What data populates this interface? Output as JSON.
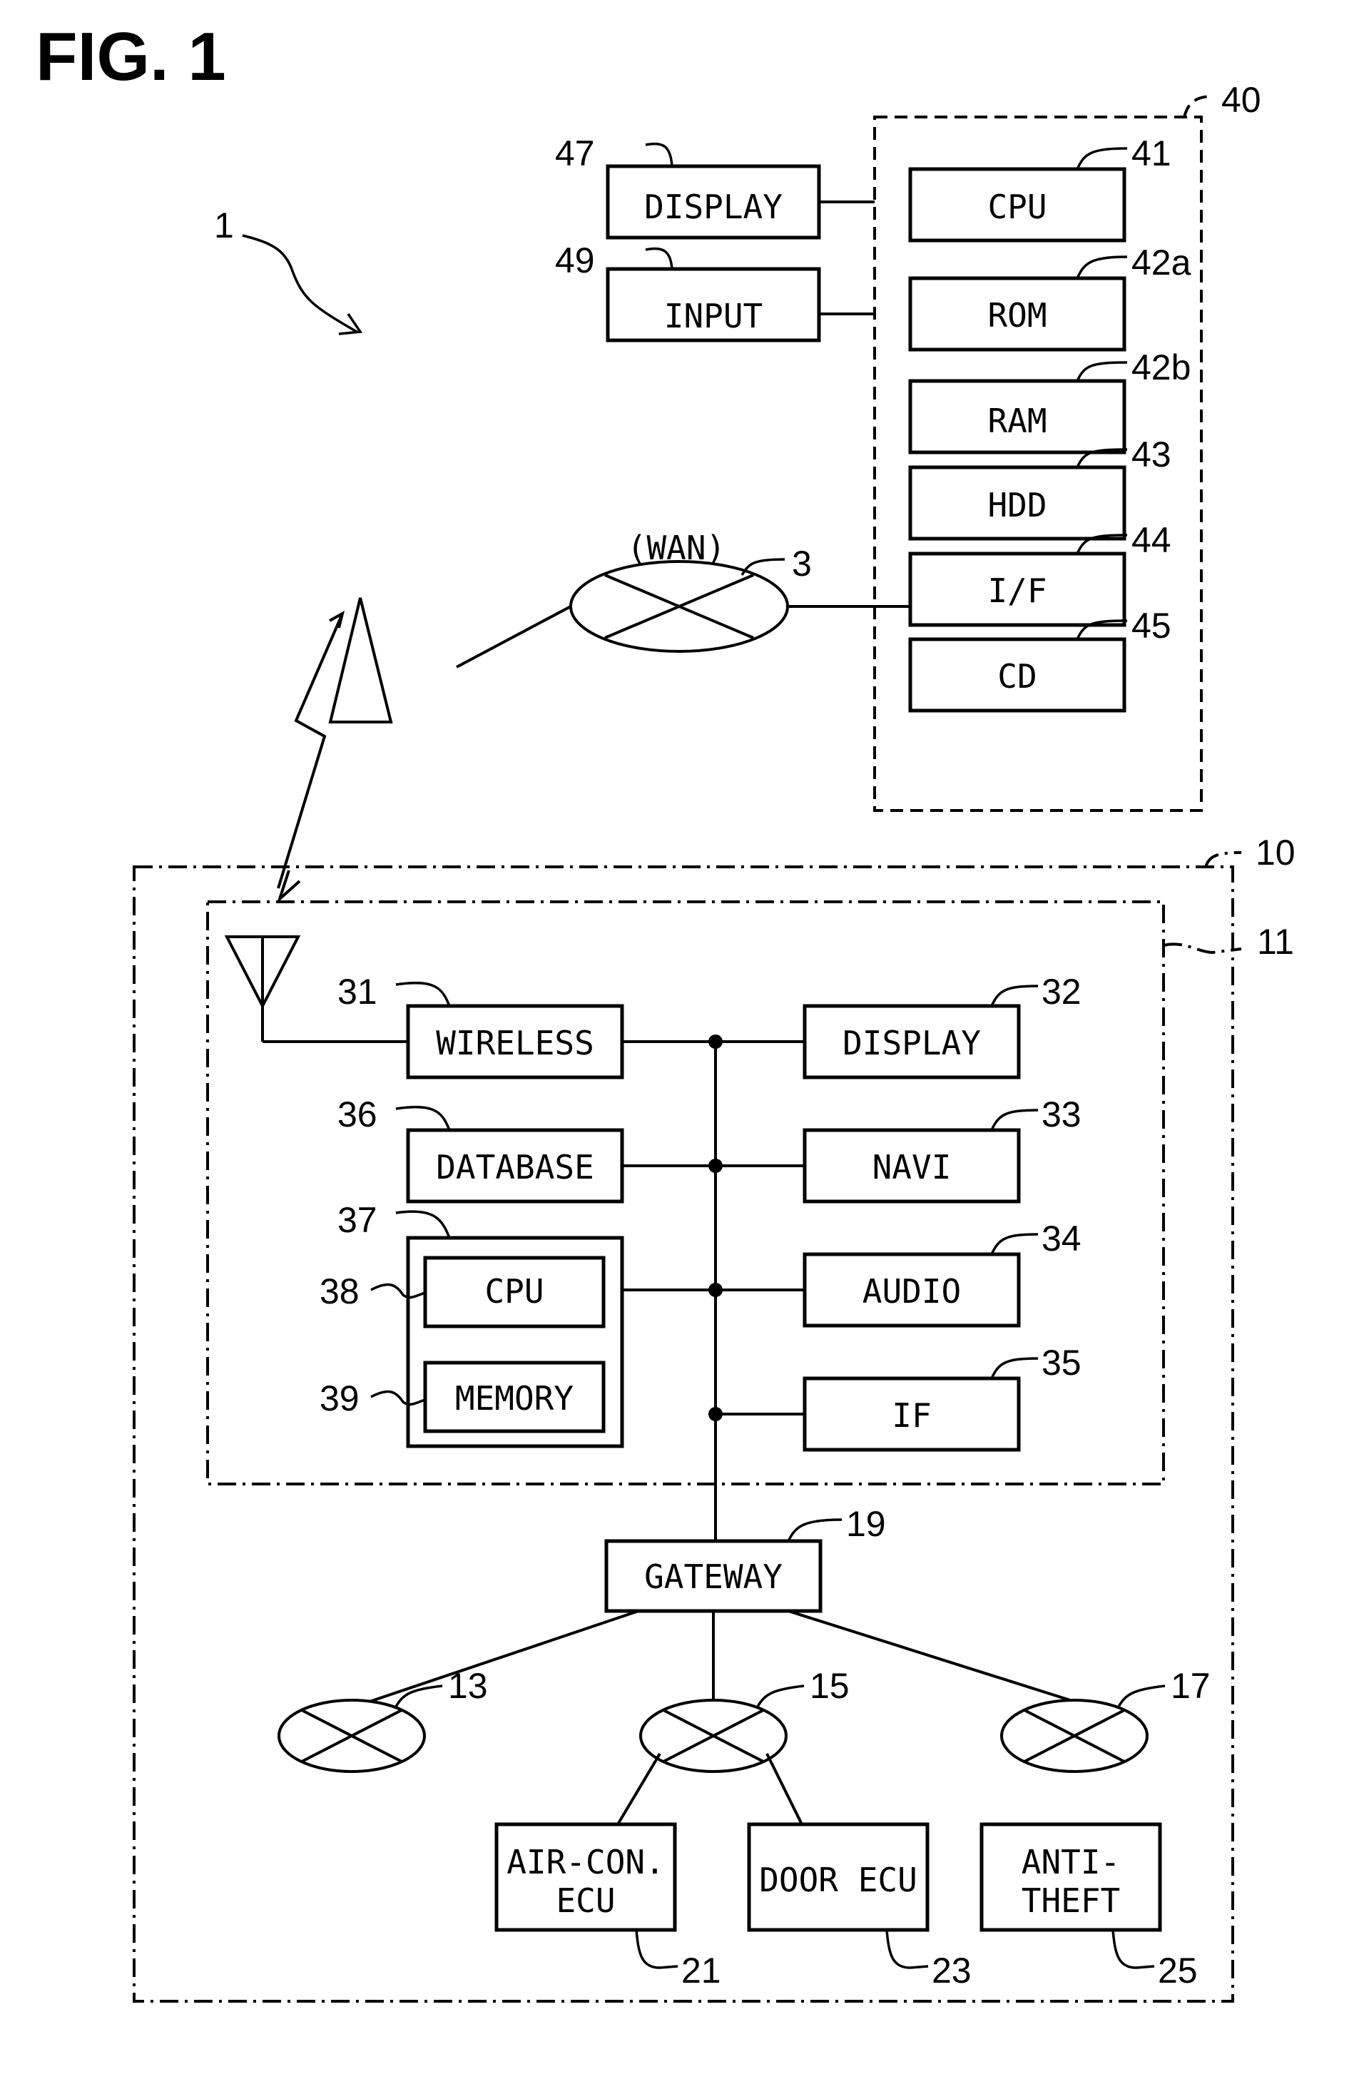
{
  "figure": {
    "title": "FIG. 1",
    "system_ref": "1"
  },
  "server": {
    "ref": "40",
    "components": [
      {
        "ref": "41",
        "label": "CPU"
      },
      {
        "ref": "42a",
        "label": "ROM"
      },
      {
        "ref": "42b",
        "label": "RAM"
      },
      {
        "ref": "43",
        "label": "HDD"
      },
      {
        "ref": "44",
        "label": "I/F"
      },
      {
        "ref": "45",
        "label": "CD"
      }
    ],
    "peripherals": [
      {
        "ref": "47",
        "label": "DISPLAY"
      },
      {
        "ref": "49",
        "label": "INPUT"
      }
    ]
  },
  "network": {
    "label": "(WAN)",
    "ref": "3"
  },
  "vehicle": {
    "ref": "10",
    "unit": {
      "ref": "11",
      "left_components": [
        {
          "ref": "31",
          "label": "WIRELESS"
        },
        {
          "ref": "36",
          "label": "DATABASE"
        }
      ],
      "controller": {
        "ref": "37",
        "parts": [
          {
            "ref": "38",
            "label": "CPU"
          },
          {
            "ref": "39",
            "label": "MEMORY"
          }
        ]
      },
      "right_components": [
        {
          "ref": "32",
          "label": "DISPLAY"
        },
        {
          "ref": "33",
          "label": "NAVI"
        },
        {
          "ref": "34",
          "label": "AUDIO"
        },
        {
          "ref": "35",
          "label": "IF"
        }
      ]
    },
    "gateway": {
      "ref": "19",
      "label": "GATEWAY"
    },
    "buses": [
      {
        "ref": "13"
      },
      {
        "ref": "15"
      },
      {
        "ref": "17"
      }
    ],
    "ecus": [
      {
        "ref": "21",
        "line1": "AIR-CON.",
        "line2": "ECU"
      },
      {
        "ref": "23",
        "line1": "DOOR ECU",
        "line2": ""
      },
      {
        "ref": "25",
        "line1": "ANTI-",
        "line2": "THEFT"
      }
    ]
  }
}
